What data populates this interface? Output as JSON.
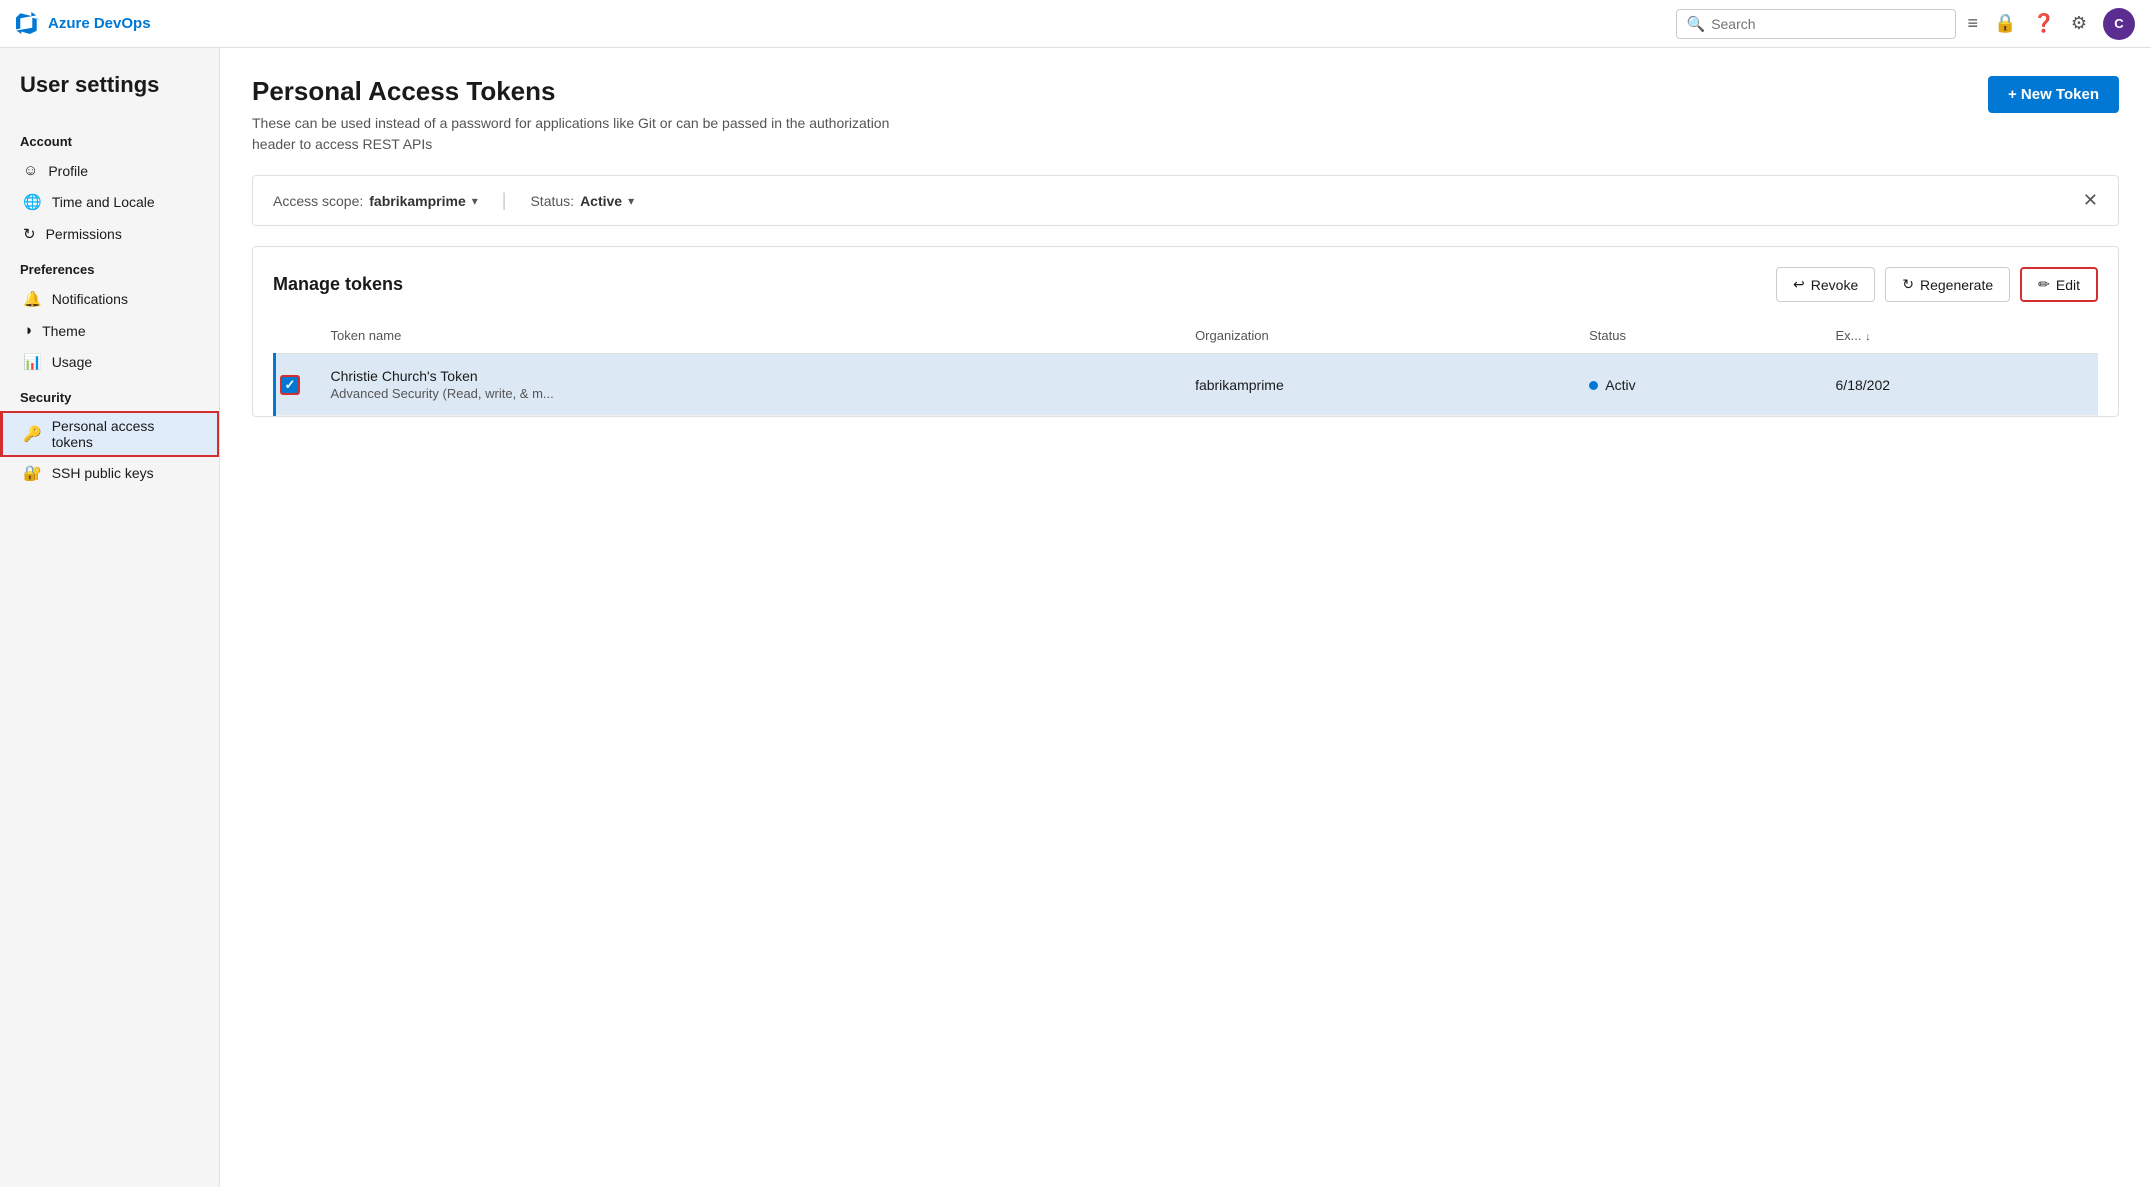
{
  "app": {
    "name": "Azure DevOps",
    "logo_color": "#0078d4"
  },
  "nav": {
    "search_placeholder": "Search",
    "icons": [
      "task-list-icon",
      "lock-icon",
      "help-icon",
      "settings-icon"
    ],
    "avatar_initials": "C"
  },
  "sidebar": {
    "title": "User settings",
    "sections": [
      {
        "label": "Account",
        "items": [
          {
            "id": "profile",
            "label": "Profile",
            "icon": "👤"
          },
          {
            "id": "time-locale",
            "label": "Time and Locale",
            "icon": "🌐"
          },
          {
            "id": "permissions",
            "label": "Permissions",
            "icon": "↻"
          }
        ]
      },
      {
        "label": "Preferences",
        "items": [
          {
            "id": "notifications",
            "label": "Notifications",
            "icon": "🔔"
          },
          {
            "id": "theme",
            "label": "Theme",
            "icon": "◑"
          },
          {
            "id": "usage",
            "label": "Usage",
            "icon": "📊"
          }
        ]
      },
      {
        "label": "Security",
        "items": [
          {
            "id": "personal-access-tokens",
            "label": "Personal access tokens",
            "icon": "🔑",
            "active": true
          },
          {
            "id": "ssh-public-keys",
            "label": "SSH public keys",
            "icon": "🔐"
          }
        ]
      }
    ]
  },
  "main": {
    "page_title": "Personal Access Tokens",
    "page_description": "These can be used instead of a password for applications like Git or can be passed in the authorization header to access REST APIs",
    "new_token_btn": "+ New Token",
    "filter": {
      "scope_label": "Access scope:",
      "scope_value": "fabrikamprime",
      "status_label": "Status:",
      "status_value": "Active"
    },
    "manage_tokens": {
      "title": "Manage tokens",
      "revoke_btn": "Revoke",
      "regenerate_btn": "Regenerate",
      "edit_btn": "Edit",
      "columns": [
        {
          "id": "name",
          "label": "Token name"
        },
        {
          "id": "org",
          "label": "Organization"
        },
        {
          "id": "status",
          "label": "Status"
        },
        {
          "id": "expiry",
          "label": "Ex...",
          "sorted": true
        }
      ],
      "tokens": [
        {
          "id": 1,
          "name": "Christie Church's Token",
          "scope": "Advanced Security (Read, write, & m...",
          "organization": "fabrikamprime",
          "status": "Activ",
          "expiry": "6/18/202",
          "selected": true
        }
      ]
    }
  }
}
